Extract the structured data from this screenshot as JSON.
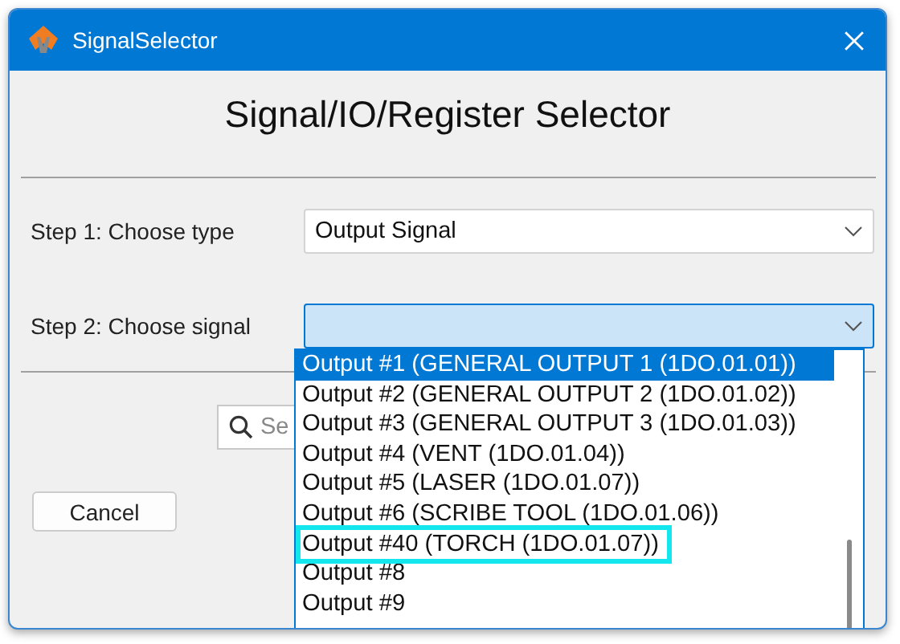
{
  "window": {
    "title": "SignalSelector"
  },
  "heading": "Signal/IO/Register Selector",
  "steps": [
    {
      "label": "Step 1: Choose type",
      "value": "Output Signal",
      "focused": false
    },
    {
      "label": "Step 2: Choose signal",
      "focused": true
    }
  ],
  "search": {
    "placeholder": "Se"
  },
  "buttons": [
    "Cancel"
  ],
  "dropdown": {
    "items": [
      {
        "label": "Output #1 (GENERAL OUTPUT 1 (1DO.01.01))",
        "selected": true,
        "highlighted": false
      },
      {
        "label": "Output #2 (GENERAL OUTPUT 2 (1DO.01.02))",
        "selected": false,
        "highlighted": false
      },
      {
        "label": "Output #3 (GENERAL OUTPUT 3 (1DO.01.03))",
        "selected": false,
        "highlighted": false
      },
      {
        "label": "Output #4 (VENT (1DO.01.04))",
        "selected": false,
        "highlighted": false
      },
      {
        "label": "Output #5 (LASER (1DO.01.07))",
        "selected": false,
        "highlighted": false
      },
      {
        "label": "Output #6 (SCRIBE TOOL (1DO.01.06))",
        "selected": false,
        "highlighted": false
      },
      {
        "label": "Output #40 (TORCH (1DO.01.07))",
        "selected": false,
        "highlighted": true
      },
      {
        "label": "Output #8",
        "selected": false,
        "highlighted": false
      },
      {
        "label": "Output #9",
        "selected": false,
        "highlighted": false
      }
    ]
  }
}
